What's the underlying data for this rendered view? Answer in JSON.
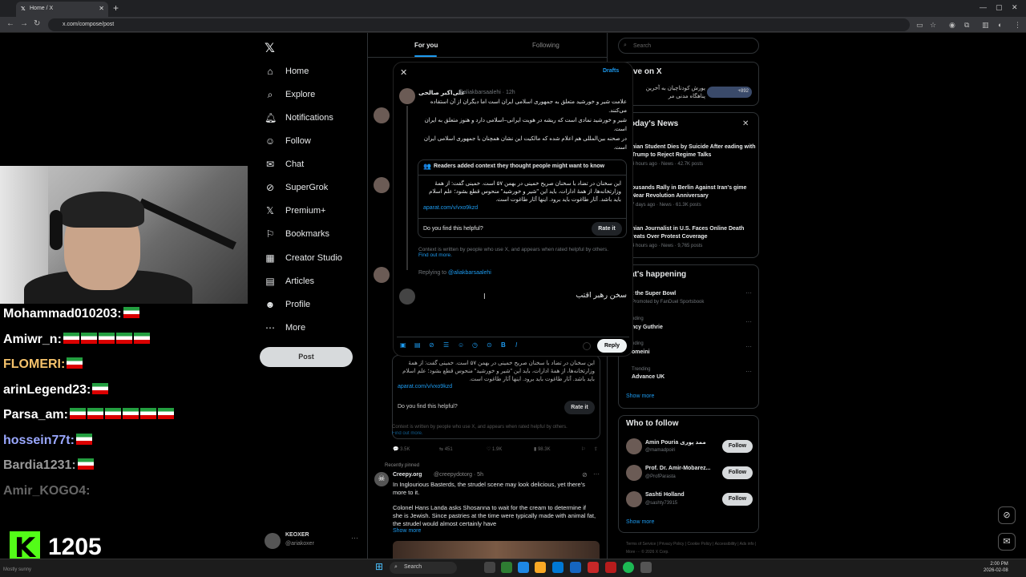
{
  "browser": {
    "tab_title": "Home / X",
    "url": "x.com/compose/post"
  },
  "nav": {
    "items": [
      {
        "label": "Home",
        "icon": "home-icon"
      },
      {
        "label": "Explore",
        "icon": "search-icon"
      },
      {
        "label": "Notifications",
        "icon": "bell-icon"
      },
      {
        "label": "Follow",
        "icon": "person-plus-icon"
      },
      {
        "label": "Chat",
        "icon": "chat-icon"
      },
      {
        "label": "SuperGrok",
        "icon": "grok-icon"
      },
      {
        "label": "Premium+",
        "icon": "x-icon"
      },
      {
        "label": "Bookmarks",
        "icon": "bookmark-icon"
      },
      {
        "label": "Creator Studio",
        "icon": "creator-icon"
      },
      {
        "label": "Articles",
        "icon": "articles-icon"
      },
      {
        "label": "Profile",
        "icon": "profile-icon"
      },
      {
        "label": "More",
        "icon": "more-icon"
      }
    ],
    "post_button": "Post",
    "account_name": "KEOXER",
    "account_handle": "@ariakoxer"
  },
  "timeline": {
    "tab_for_you": "For you",
    "tab_following": "Following",
    "bg_note_text": "این سخنان در تضاد با سخنان صریح خمینی در بهمن ۵۷ است. خمینی گفت: از همهٔ وزارتخانه‌ها، از همهٔ ادارات، باید این \"شیر و خورشید\" منحوس قطع بشود؛ علم اسلام باید باشد. آثار طاغوت باید برود. اینها آثار طاغوت است.",
    "bg_note_link": "aparat.com/v/vxo9kzd",
    "bg_note_question": "Do you find this helpful?",
    "bg_note_rate": "Rate it",
    "bg_ctx": "Context is written by people who use X, and appears when rated helpful by others.",
    "bg_find_more": "Find out more.",
    "stats": [
      "3.5K",
      "451",
      "1.9K",
      "98.3K"
    ],
    "pinned_label": "Recently pinned",
    "creepy_name": "Creepy.org",
    "creepy_handle": "@creepydotorg · 5h",
    "creepy_text1": "In Inglourious Basterds, the strudel scene may look delicious, yet there's more to it.",
    "creepy_text2": "Colonel Hans Landa asks Shosanna to wait for the cream to determine if she is Jewish. Since pastries at the time were typically made with animal fat, the strudel would almost certainly have",
    "show_more": "Show more"
  },
  "modal": {
    "close": "✕",
    "drafts": "Drafts",
    "author_name": "علی‌اکبر صالحی",
    "author_handle": "@aliakbarsaalehi · 12h",
    "tweet_lines": [
      "علامت شیر و خورشید متعلق به جمهوری اسلامی ایران است اما دیگران از آن استفاده می‌کنند.",
      "شیر و خورشید نمادی است که ریشه در هویت ایرانی–اسلامی دارد و هنوز متعلق به ایران است.",
      "در صحنه بین‌المللی هم اعلام شده که مالکیت این نشان همچنان با جمهوری اسلامی ایران است."
    ],
    "note_header": "Readers added context they thought people might want to know",
    "note_text": "این سخنان در تضاد با سخنان صریح خمینی در بهمن ۵۷ است. خمینی گفت: از همهٔ وزارتخانه‌ها، از همهٔ ادارات، باید این \"شیر و خورشید\" منحوس قطع بشود؛ علم اسلام باید باشد. آثار طاغوت باید برود. اینها آثار طاغوت است.",
    "note_link": "aparat.com/v/vxo9kzd",
    "note_question": "Do you find this helpful?",
    "note_rate": "Rate it",
    "ctx_text": "Context is written by people who use X, and appears when rated helpful by others.",
    "ctx_more": "Find out more.",
    "replying_prefix": "Replying to",
    "replying_handle": "@aliakbarsaalehi",
    "composer_text": "سخن رهبر اقتب",
    "reply_button": "Reply"
  },
  "right": {
    "search_placeholder": "Search",
    "live_title": "ve on X",
    "live_text": "یورش کودتاچیان به آخرین پناهگاه مدنی مر",
    "live_count": "+892",
    "news_title": "oday's News",
    "news": [
      {
        "title": "nian Student Dies by Suicide After eading with Trump to Reject Regime Talks",
        "meta": "4 hours ago · News · 42.7K posts"
      },
      {
        "title": "ousands Rally in Berlin Against Iran's gime Near Revolution Anniversary",
        "meta": "7 days ago · News · 61.3K posts"
      },
      {
        "title": "nian Journalist in U.S. Faces Online Death reats Over Protest Coverage",
        "meta": "4 hours ago · News · 9,765 posts"
      }
    ],
    "happening_title": "at's happening",
    "happening": [
      {
        "title": "t the Super Bowl",
        "meta": "Promoted by FanDuel Sportsbook"
      },
      {
        "title": "ncy Guthrie",
        "meta": "nding"
      },
      {
        "title": "omeini",
        "meta": "nding"
      },
      {
        "title": "Advance UK",
        "meta": "Trending"
      }
    ],
    "show_more": "Show more",
    "wtf_title": "Who to follow",
    "wtf": [
      {
        "name": "Amin Pouria ممد پوری",
        "handle": "@mamadpoiri",
        "btn": "Follow"
      },
      {
        "name": "Prof. Dr. Amir-Mobarez...",
        "handle": "@ProfParasta",
        "btn": "Follow"
      },
      {
        "name": "Sashti Holland",
        "handle": "@sashty73915",
        "btn": "Follow"
      }
    ],
    "wtf_show_more": "Show more",
    "footer": "Terms of Service | Privacy Policy | Cookie Policy | Accessibility | Ads info | More ··· © 2026 X Corp."
  },
  "stream": {
    "chat": [
      {
        "user": "Mohammad010203:",
        "color": "#ffffff",
        "flags": 1
      },
      {
        "user": "Amiwr_n:",
        "color": "#ffffff",
        "flags": 5
      },
      {
        "user": "FLOMERI:",
        "color": "#f5c26b",
        "flags": 1
      },
      {
        "user": "arinLegend23:",
        "color": "#ffffff",
        "flags": 1
      },
      {
        "user": "Parsa_am:",
        "color": "#ffffff",
        "flags": 6
      },
      {
        "user": "hossein77t:",
        "color": "#9aa8ff",
        "flags": 1
      },
      {
        "user": "Bardia1231:",
        "color": "#9a9a9a",
        "flags": 1
      },
      {
        "user": "Amir_KOGO4:",
        "color": "#666666",
        "flags": 0
      }
    ],
    "counter": "1205",
    "counter_logo": "K",
    "counter_sub": "Mostly sunny"
  },
  "taskbar": {
    "search": "Search",
    "time": "2:00 PM",
    "date": "2026-02-08"
  }
}
